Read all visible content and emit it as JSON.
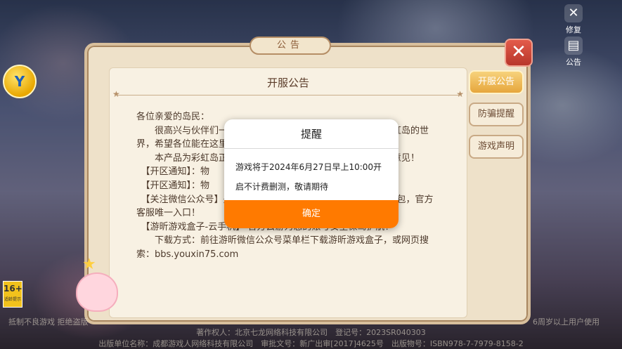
{
  "tools": {
    "repair_label": "修复",
    "notice_label": "公告"
  },
  "board": {
    "title": "公告",
    "tabs": [
      "开服公告",
      "防骗提醒",
      "游戏声明"
    ],
    "active_tab_index": 0,
    "notice_title": "开服公告",
    "notice_paragraphs": [
      "各位亲爱的岛民：",
      "　　很高兴与伙伴们一起踏上彩虹岛的世界，我们尽力重现了彩虹岛的世界，希望各位能在这里寻找爱丽丝贡献一份心力~",
      "　　本产品为彩虹岛正版授权手游，希望诸多玩家给与宝贵优化意见！",
      "　【开区通知】：物",
      "　【开区通知】：物",
      "　【关注微信公众号】关注官方公众号获取最新资讯，领取关注礼包，官方客服唯一入口！",
      "　【游昕游戏盒子-云手机】 官方云游为您的账号安全保驾护航！",
      "　　下载方式：前往游昕微信公众号菜单栏下载游昕游戏盒子，或网页搜索：bbs.youxin75.com"
    ]
  },
  "dialog": {
    "title": "提醒",
    "message_line1": "游戏将于2024年6月27日早上10:00开",
    "message_line2": "启不计费删测，敬请期待",
    "confirm_label": "确定"
  },
  "age_rating": {
    "value": "16+",
    "caption": "适龄提示"
  },
  "footer": {
    "line1": "著作权人：北京七龙网络科技有限公司　登记号：2023SR040303",
    "line2": "出版单位名称：成都游戏人网络科技有限公司　审批文号：新广出审[2017]4625号　出版物号：ISBN978-7-7979-8158-2",
    "left_note": "抵制不良游戏 拒绝盗版",
    "right_note": "6周岁以上用户使用"
  },
  "colors": {
    "accent": "#ff7a00",
    "board_bg": "#eee1c9",
    "close_red": "#c9402f"
  }
}
